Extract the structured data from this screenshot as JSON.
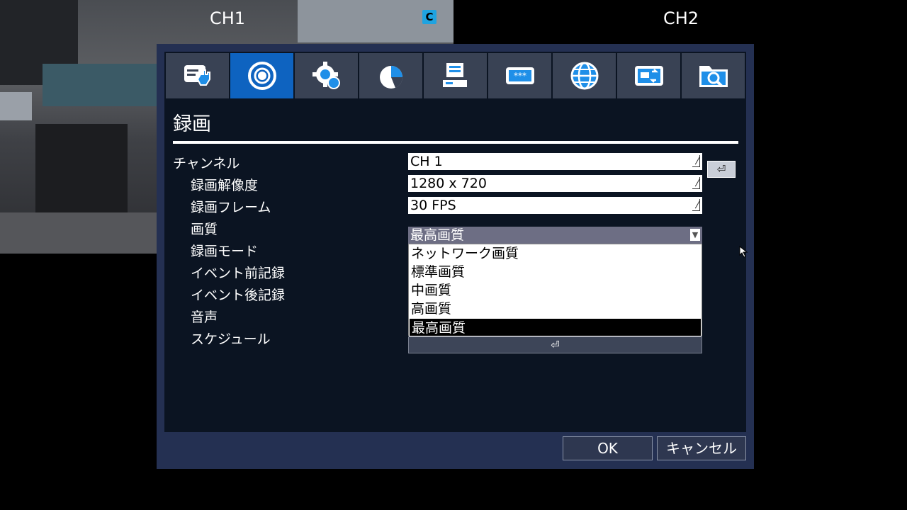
{
  "camera": {
    "ch1_label": "CH1",
    "ch2_label": "CH2",
    "overlay_icon": "C"
  },
  "tabs": [
    {
      "icon": "display-touch-icon",
      "active": false
    },
    {
      "icon": "record-icon",
      "active": true
    },
    {
      "icon": "gear-icon",
      "active": false
    },
    {
      "icon": "pie-chart-icon",
      "active": false
    },
    {
      "icon": "computer-icon",
      "active": false
    },
    {
      "icon": "password-icon",
      "active": false
    },
    {
      "icon": "globe-icon",
      "active": false
    },
    {
      "icon": "storage-swap-icon",
      "active": false
    },
    {
      "icon": "folder-search-icon",
      "active": false
    }
  ],
  "section": {
    "title": "録画"
  },
  "rows": {
    "channel": {
      "label": "チャンネル",
      "value": "CH 1",
      "enter_symbol": "⏎"
    },
    "resolution": {
      "label": "録画解像度",
      "value": "1280 x 720"
    },
    "frame": {
      "label": "録画フレーム",
      "value": "30 FPS"
    },
    "quality": {
      "label": "画質",
      "value": "最高画質",
      "arrow": "▼"
    },
    "mode": {
      "label": "録画モード"
    },
    "pre_event": {
      "label": "イベント前記録"
    },
    "post_event": {
      "label": "イベント後記録"
    },
    "audio": {
      "label": "音声"
    },
    "schedule": {
      "label": "スケジュール",
      "button_symbol": "⏎"
    }
  },
  "quality_options": [
    "ネットワーク画質",
    "標準画質",
    "中画質",
    "高画質",
    "最高画質"
  ],
  "footer": {
    "ok": "OK",
    "cancel": "キャンセル"
  },
  "colors": {
    "active_tab": "#0e63c0",
    "dialog_bg": "#243052",
    "panel_bg": "#0b1422"
  }
}
